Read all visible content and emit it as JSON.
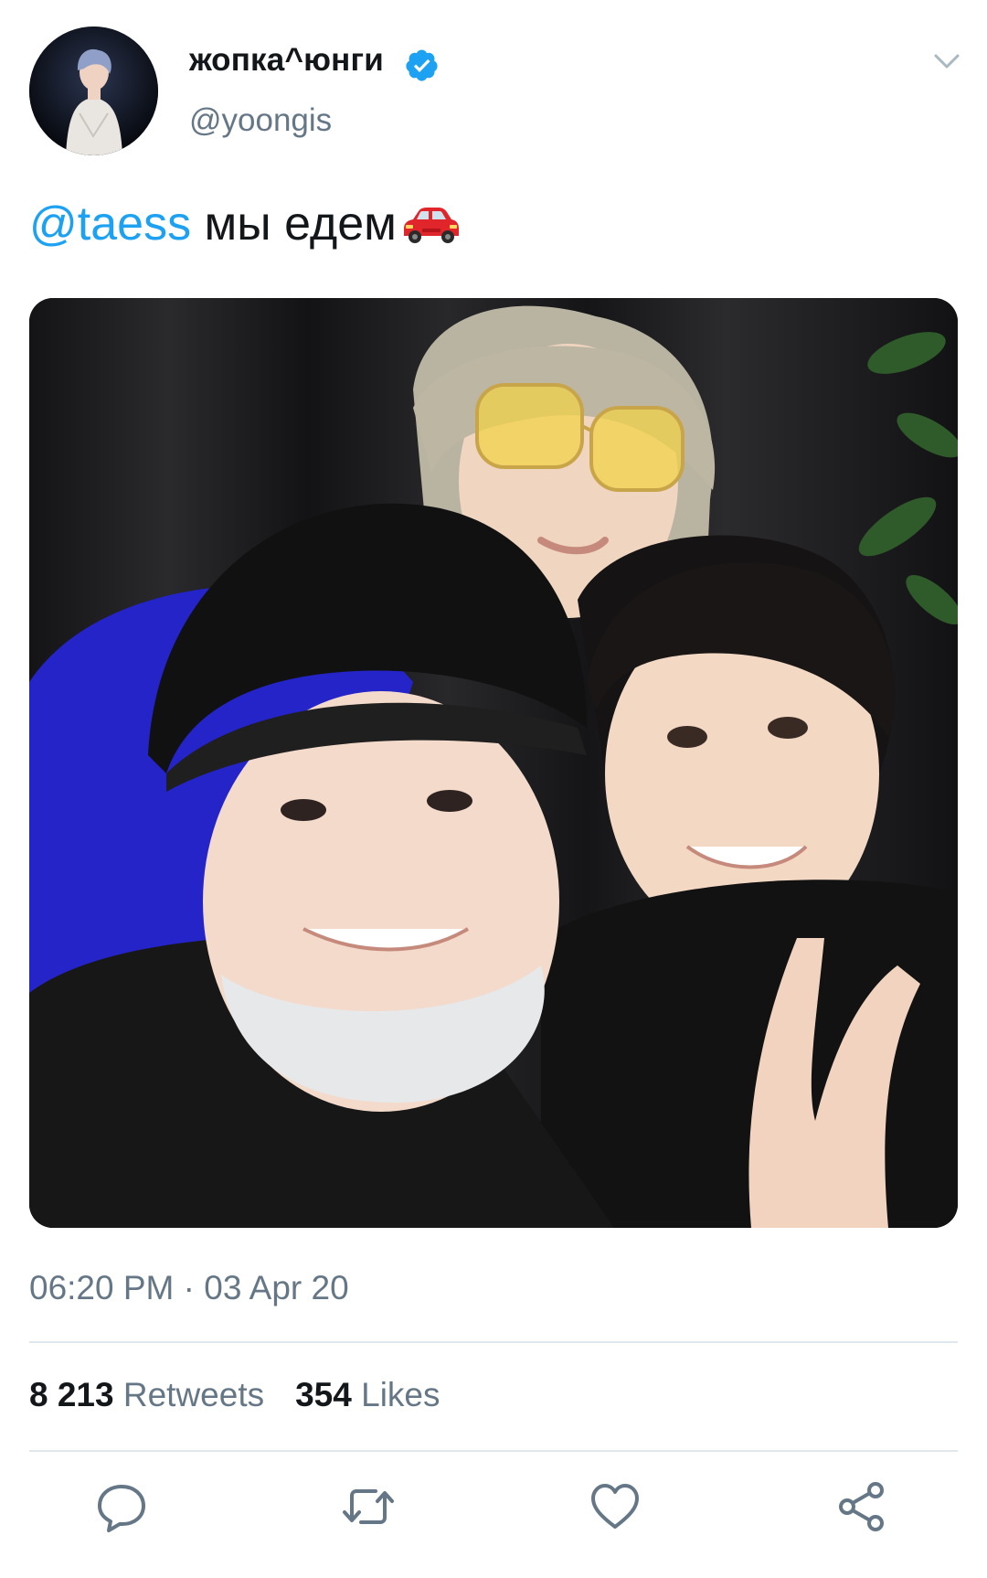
{
  "author": {
    "display_name": "жопка^юнги",
    "handle": "@yoongis",
    "verified": true
  },
  "tweet": {
    "mention": "@taess",
    "text": " мы едем",
    "emoji": "red-car"
  },
  "meta": {
    "timestamp": "06:20 PM · 03 Apr 20"
  },
  "stats": {
    "retweets_count": "8 213",
    "retweets_label": "Retweets",
    "likes_count": "354",
    "likes_label": "Likes"
  },
  "actions": [
    "reply-icon",
    "retweet-icon",
    "like-icon",
    "share-icon"
  ],
  "colors": {
    "accent": "#1da1f2",
    "secondary_text": "#657786",
    "primary_text": "#14171a",
    "divider": "#e1e8ed"
  }
}
